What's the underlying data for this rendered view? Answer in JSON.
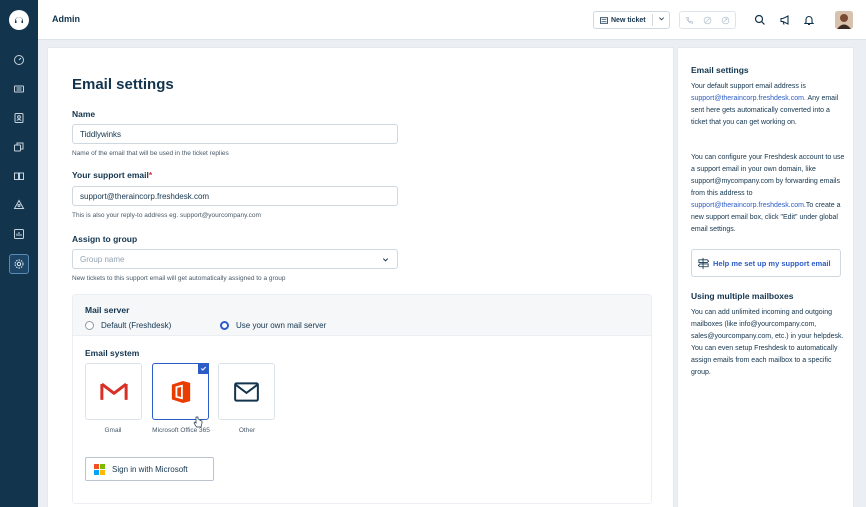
{
  "header": {
    "title": "Admin",
    "new_ticket_label": "New ticket"
  },
  "sidebar": {
    "items": [
      "dashboard-icon",
      "tickets-icon",
      "contacts-icon",
      "groups-icon",
      "solutions-icon",
      "network-icon",
      "reports-icon",
      "admin-gear-icon"
    ]
  },
  "form": {
    "title": "Email settings",
    "name_label": "Name",
    "name_value": "Tiddlywinks",
    "name_hint": "Name of the email that will be used in the ticket replies",
    "email_label": "Your support email",
    "email_required_mark": "*",
    "email_value": "support@theraincorp.freshdesk.com",
    "email_hint": "This is also your reply-to address eg. support@yourcompany.com",
    "group_label": "Assign to group",
    "group_placeholder": "Group name",
    "group_hint": "New tickets to this support email will get automatically assigned to a group",
    "mail_server_label": "Mail server",
    "radio_default": "Default (Freshdesk)",
    "radio_own": "Use your own mail server",
    "email_system_label": "Email system",
    "tiles": [
      {
        "label": "Gmail"
      },
      {
        "label": "Microsoft Office 365"
      },
      {
        "label": "Other"
      }
    ],
    "sign_in_label": "Sign in with Microsoft"
  },
  "right_panel": {
    "title1": "Email settings",
    "p1_pre": "Your default support email address is ",
    "p1_link": "support@theraincorp.freshdesk.com.",
    "p1_post": " Any email sent here gets automatically converted into a ticket that you can get working on.",
    "p2_pre": "You can configure your Freshdesk account to use a support email in your own domain, like support@mycompany.com by forwarding emails from this address to ",
    "p2_link": "support@theraincorp.freshdesk.com.",
    "p2_post": "To create a new support email box, click \"Edit\" under global email settings.",
    "help_button": "Help me set up my support email",
    "title2": "Using multiple mailboxes",
    "p3": "You can add unlimited incoming and outgoing mailboxes (like info@yourcompany.com, sales@yourcompany.com, etc.) in your helpdesk. You can even setup Freshdesk to automatically assign emails from each mailbox to a specific group."
  },
  "colors": {
    "sidebar": "#12344d",
    "accent": "#2c5cc5",
    "gmail_red": "#d93025",
    "office_orange": "#eb3c00"
  }
}
